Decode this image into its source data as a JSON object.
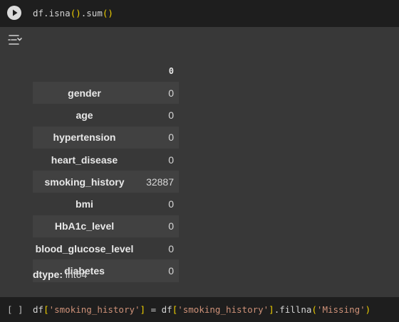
{
  "cells": [
    {
      "code": {
        "p1": "df.isna",
        "p2": "()",
        "p3": ".sum",
        "p4": "()"
      }
    },
    {
      "prompt": "[ ]",
      "code": {
        "p1": "df",
        "p2": "[",
        "p3": "'smoking_history'",
        "p4": "]",
        "p5": " = df",
        "p6": "[",
        "p7": "'smoking_history'",
        "p8": "]",
        "p9": ".fillna",
        "p10": "(",
        "p11": "'Missing'",
        "p12": ")"
      }
    }
  ],
  "output": {
    "column_header": "0",
    "rows": [
      {
        "label": "gender",
        "value": "0"
      },
      {
        "label": "age",
        "value": "0"
      },
      {
        "label": "hypertension",
        "value": "0"
      },
      {
        "label": "heart_disease",
        "value": "0"
      },
      {
        "label": "smoking_history",
        "value": "32887"
      },
      {
        "label": "bmi",
        "value": "0"
      },
      {
        "label": "HbA1c_level",
        "value": "0"
      },
      {
        "label": "blood_glucose_level",
        "value": "0"
      },
      {
        "label": "diabetes",
        "value": "0"
      }
    ],
    "dtype_label": "dtype:",
    "dtype_value": " int64"
  },
  "icons": {
    "run": "play-icon",
    "output_toggle": "output-toggle-icon"
  },
  "colors": {
    "code_bg": "#1e1e1e",
    "output_bg": "#383838",
    "row_alt_bg": "#414141",
    "paren": "#f0d000",
    "string": "#ce9178"
  }
}
